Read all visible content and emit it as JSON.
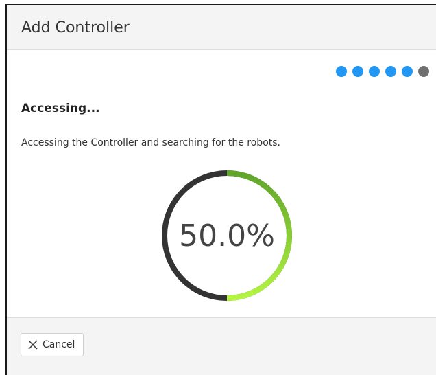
{
  "dialog": {
    "title": "Add Controller",
    "steps": {
      "total": 6,
      "current": 6
    },
    "heading": "Accessing...",
    "description": "Accessing the Controller and searching for the robots.",
    "progress": {
      "value": 0.5,
      "label": "50.0%"
    },
    "cancel_label": "Cancel",
    "icons": {
      "cancel": "close-icon"
    },
    "colors": {
      "step_done": "#2196f3",
      "step_current": "#707070",
      "ring_track": "#333333",
      "ring_fill_start": "#5fa52a",
      "ring_fill_end": "#b4f542"
    }
  }
}
